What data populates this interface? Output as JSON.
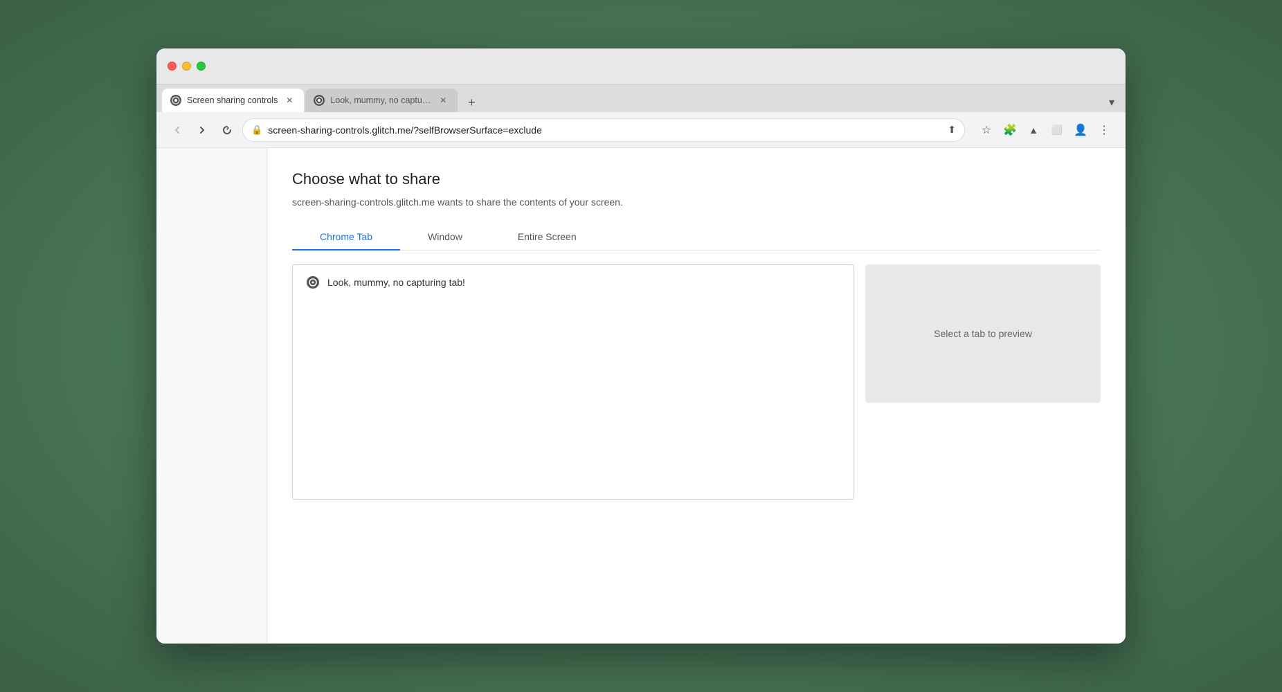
{
  "browser": {
    "window": {
      "traffic_lights": {
        "close": "close",
        "minimize": "minimize",
        "maximize": "maximize"
      }
    },
    "tabs": [
      {
        "id": "tab-1",
        "title": "Screen sharing controls",
        "url": "screen-sharing-controls.glitch.me/?selfBrowserSurface=exclude",
        "active": true
      },
      {
        "id": "tab-2",
        "title": "Look, mummy, no capturing ta",
        "url": "",
        "active": false
      }
    ],
    "tab_new_label": "+",
    "tab_dropdown_label": "▾",
    "address_bar": {
      "url": "screen-sharing-controls.glitch.me/?selfBrowserSurface=exclude",
      "lock_icon": "🔒"
    },
    "toolbar_icons": [
      "⬆",
      "☆",
      "🧩",
      "▲",
      "⬜",
      "👤",
      "⋮"
    ]
  },
  "dialog": {
    "title": "Choose what to share",
    "subtitle": "screen-sharing-controls.glitch.me wants to share the contents of your screen.",
    "tabs": [
      {
        "id": "chrome-tab",
        "label": "Chrome Tab",
        "active": true
      },
      {
        "id": "window",
        "label": "Window",
        "active": false
      },
      {
        "id": "entire-screen",
        "label": "Entire Screen",
        "active": false
      }
    ],
    "tab_list": {
      "items": [
        {
          "id": "item-1",
          "favicon": "🌐",
          "title": "Look, mummy, no capturing tab!"
        }
      ]
    },
    "preview": {
      "placeholder": "Select a tab to preview"
    }
  }
}
